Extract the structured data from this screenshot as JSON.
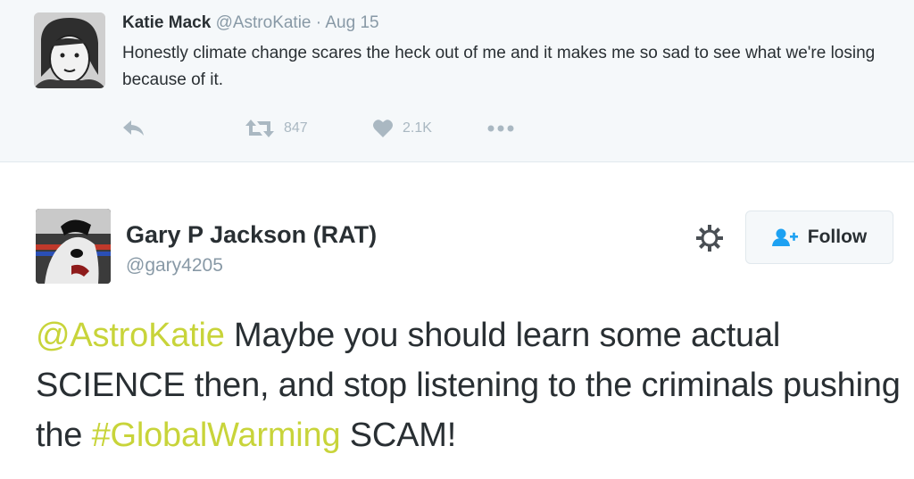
{
  "top_tweet": {
    "name": "Katie Mack",
    "handle": "@AstroKatie",
    "separator": "·",
    "date": "Aug 15",
    "text": "Honestly climate change scares the heck out of me and it makes me so sad to see what we're losing because of it.",
    "retweets": "847",
    "likes": "2.1K",
    "icons": {
      "reply": "reply-icon",
      "retweet": "retweet-icon",
      "like": "heart-icon",
      "more": "more-dots-icon"
    }
  },
  "main_tweet": {
    "name": "Gary P Jackson (RAT)",
    "handle": "@gary4205",
    "follow_label": "Follow",
    "text_parts": {
      "mention": "@AstroKatie",
      "part1": " Maybe you should learn some actual SCIENCE then, and stop listening to the criminals pushing the ",
      "hashtag": "#GlobalWarming",
      "part2": " SCAM!"
    },
    "icons": {
      "settings": "gear-icon",
      "follow": "add-user-icon"
    }
  },
  "colors": {
    "background_top": "#f5f8fa",
    "text": "#292f33",
    "muted": "#8899a6",
    "icon_gray": "#aab8c2",
    "link_highlight": "#c8d43a",
    "follow_icon": "#1da1f2"
  }
}
